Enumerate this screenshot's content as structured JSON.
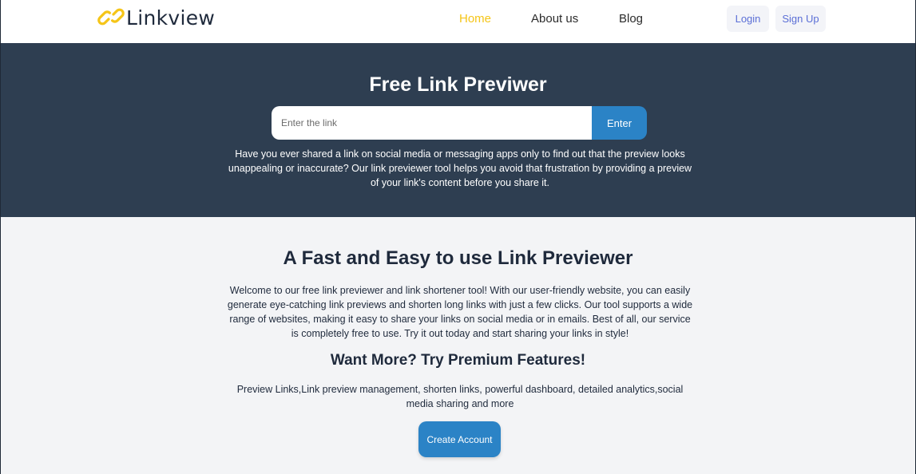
{
  "brand": {
    "name": "Linkview",
    "accent_color": "#f5c518",
    "icon": "chain-link-icon"
  },
  "nav": {
    "home": "Home",
    "about": "About us",
    "blog": "Blog",
    "active": "Home"
  },
  "auth": {
    "login": "Login",
    "signup": "Sign Up"
  },
  "hero": {
    "title": "Free Link Previwer",
    "search_placeholder": "Enter the link",
    "search_value": "",
    "enter_label": "Enter",
    "description": "Have you ever shared a link on social media or messaging apps only to find out that the preview looks unappealing or inaccurate? Our link previewer tool helps you avoid that frustration by providing a preview of your link's content before you share it."
  },
  "main": {
    "title": "A Fast and Easy to use Link Previewer",
    "description": "Welcome to our free link previewer and link shortener tool! With our user-friendly website, you can easily generate eye-catching link previews and shorten long links with just a few clicks. Our tool supports a wide range of websites, making it easy to share your links on social media or in emails. Best of all, our service is completely free to use. Try it out today and start sharing your links in style!",
    "premium_title": "Want More? Try Premium Features!",
    "premium_description": "Preview Links,Link preview management, shorten links, powerful dashboard, detailed analytics,social media sharing and more",
    "create_account": "Create Account"
  },
  "colors": {
    "hero_bg": "#2e3e51",
    "primary_button": "#2b83c6",
    "main_bg": "#f3f4f6",
    "text_dark": "#1f2a3c"
  }
}
